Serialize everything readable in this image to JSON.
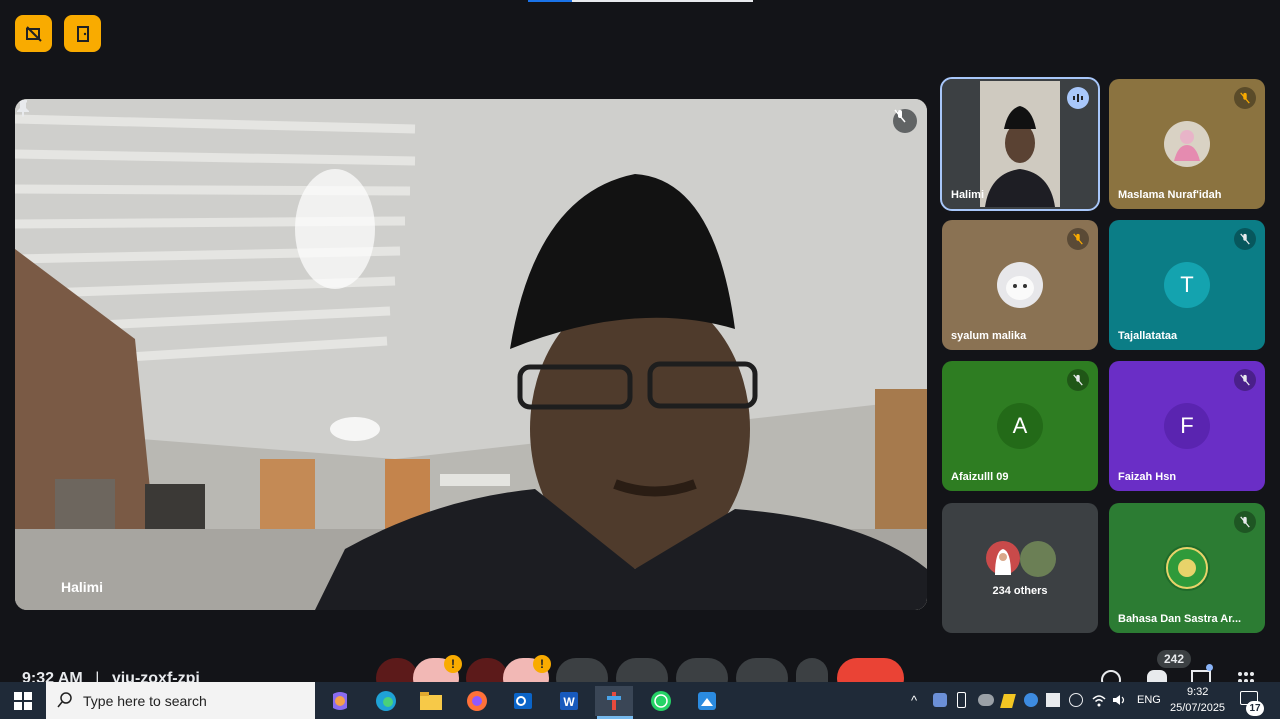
{
  "meeting": {
    "time": "9:32 AM",
    "separator": "|",
    "code": "yiu-zoxf-zpi",
    "presenter": {
      "name": "Halimi"
    },
    "others_count": "234 others",
    "people_count": "242",
    "participants": [
      {
        "name": "Halimi",
        "speaking": true,
        "color": "#3c4043"
      },
      {
        "name": "Maslama Nuraf'idah",
        "color": "#8b7340"
      },
      {
        "name": "syalum malika",
        "color": "#8a7253"
      },
      {
        "name": "Tajallatataa",
        "initial": "T",
        "color": "#0b7d86"
      },
      {
        "name": "Afaizulll 09",
        "initial": "A",
        "color": "#2e7d22"
      },
      {
        "name": "Faizah Hsn",
        "initial": "F",
        "color": "#6a2ec6"
      },
      {
        "name": "Bahasa Dan Sastra Ar...",
        "color": "#2c7c33"
      }
    ]
  },
  "colors": {
    "accent": "#f9ab00",
    "end_call": "#ea4335",
    "speaking_outline": "#a8c7fa"
  },
  "taskbar": {
    "search_placeholder": "Type here to search",
    "language": "ENG",
    "clock_time": "9:32",
    "clock_date": "25/07/2025",
    "notification_count": "17",
    "apps": [
      "copilot-icon",
      "edge-icon",
      "file-explorer-icon",
      "firefox-icon",
      "outlook-icon",
      "word-icon",
      "app-icon",
      "whatsapp-icon",
      "paint-icon"
    ]
  }
}
